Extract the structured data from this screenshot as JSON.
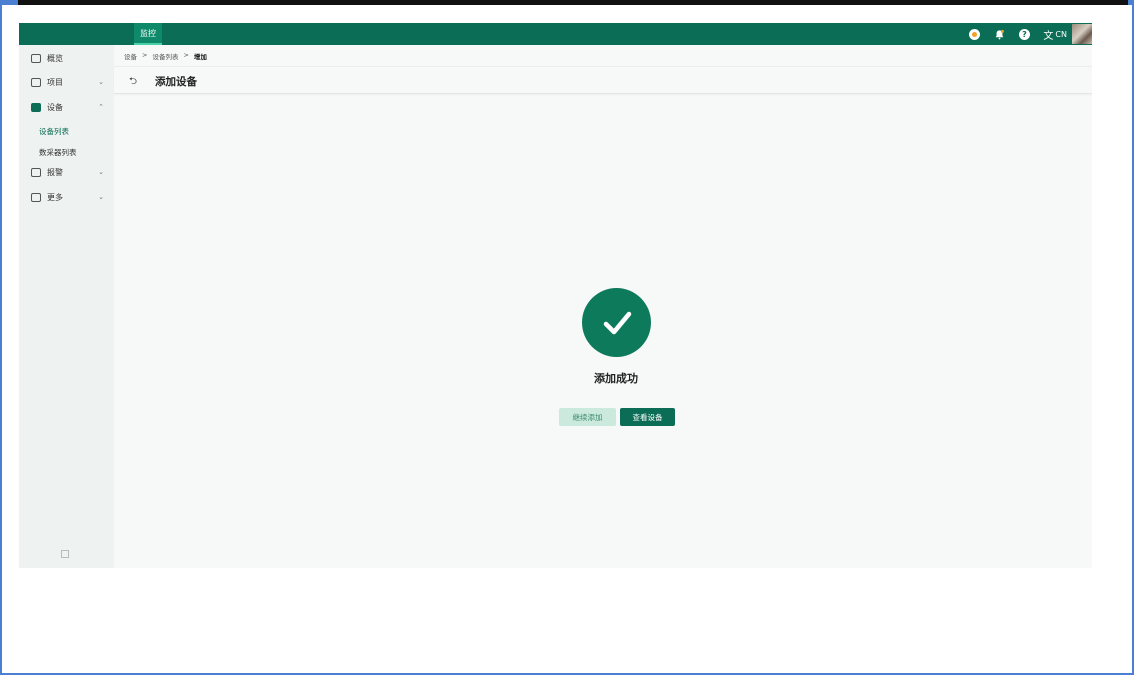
{
  "header": {
    "tab_label": "监控",
    "lang_icon": "translate-icon",
    "lang_code": "CN",
    "accent": "#0b6d55"
  },
  "sidebar": {
    "items": [
      {
        "label": "概览",
        "icon": "dashboard-icon"
      },
      {
        "label": "项目",
        "icon": "project-icon",
        "chevron": "⌄"
      },
      {
        "label": "设备",
        "icon": "device-icon",
        "chevron": "⌃"
      },
      {
        "label": "报警",
        "icon": "alarm-icon",
        "chevron": "⌄"
      },
      {
        "label": "更多",
        "icon": "more-icon",
        "chevron": "⌄"
      }
    ],
    "subitems": [
      {
        "label": "设备列表"
      },
      {
        "label": "数采器列表"
      }
    ]
  },
  "breadcrumb": {
    "items": [
      "设备",
      "设备列表",
      "增加"
    ],
    "separator": ">"
  },
  "page": {
    "title": "添加设备"
  },
  "result": {
    "message": "添加成功",
    "continue_label": "继续添加",
    "view_label": "查看设备"
  }
}
